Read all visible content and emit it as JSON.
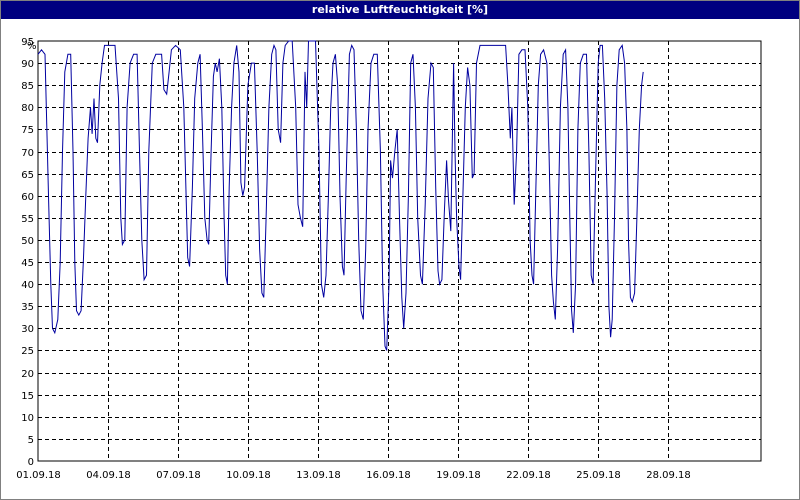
{
  "chart_data": {
    "type": "line",
    "title": "relative Luftfeuchtigkeit [%]",
    "ylabel": "%",
    "xlabel": "",
    "ylim": [
      0,
      95
    ],
    "yticks": [
      0,
      5,
      10,
      15,
      20,
      25,
      30,
      35,
      40,
      45,
      50,
      55,
      60,
      65,
      70,
      75,
      80,
      85,
      90,
      95
    ],
    "xlim": [
      0,
      31
    ],
    "xticks": [
      {
        "day": 0,
        "label": "01.09.18"
      },
      {
        "day": 3,
        "label": "04.09.18"
      },
      {
        "day": 6,
        "label": "07.09.18"
      },
      {
        "day": 9,
        "label": "10.09.18"
      },
      {
        "day": 12,
        "label": "13.09.18"
      },
      {
        "day": 15,
        "label": "16.09.18"
      },
      {
        "day": 18,
        "label": "19.09.18"
      },
      {
        "day": 21,
        "label": "22.09.18"
      },
      {
        "day": 24,
        "label": "25.09.18"
      },
      {
        "day": 27,
        "label": "28.09.18"
      }
    ],
    "grid": true,
    "line_color": "#0000a0",
    "series": [
      {
        "name": "",
        "points": [
          [
            0.0,
            92
          ],
          [
            0.15,
            93
          ],
          [
            0.3,
            92
          ],
          [
            0.45,
            60
          ],
          [
            0.55,
            40
          ],
          [
            0.62,
            30
          ],
          [
            0.72,
            29
          ],
          [
            0.85,
            32
          ],
          [
            0.95,
            45
          ],
          [
            1.05,
            70
          ],
          [
            1.15,
            88
          ],
          [
            1.28,
            92
          ],
          [
            1.4,
            92
          ],
          [
            1.5,
            70
          ],
          [
            1.58,
            45
          ],
          [
            1.65,
            34
          ],
          [
            1.75,
            33
          ],
          [
            1.85,
            34
          ],
          [
            1.95,
            46
          ],
          [
            2.05,
            60
          ],
          [
            2.15,
            73
          ],
          [
            2.25,
            80
          ],
          [
            2.32,
            74
          ],
          [
            2.4,
            82
          ],
          [
            2.48,
            73
          ],
          [
            2.55,
            72
          ],
          [
            2.65,
            85
          ],
          [
            2.75,
            90
          ],
          [
            2.85,
            94
          ],
          [
            3.1,
            94
          ],
          [
            3.3,
            94
          ],
          [
            3.45,
            82
          ],
          [
            3.55,
            55
          ],
          [
            3.62,
            49
          ],
          [
            3.72,
            50
          ],
          [
            3.82,
            80
          ],
          [
            3.95,
            90
          ],
          [
            4.1,
            92
          ],
          [
            4.25,
            92
          ],
          [
            4.35,
            70
          ],
          [
            4.45,
            50
          ],
          [
            4.55,
            41
          ],
          [
            4.65,
            42
          ],
          [
            4.75,
            70
          ],
          [
            4.9,
            90
          ],
          [
            5.05,
            92
          ],
          [
            5.3,
            92
          ],
          [
            5.4,
            84
          ],
          [
            5.52,
            83
          ],
          [
            5.62,
            88
          ],
          [
            5.72,
            93
          ],
          [
            5.9,
            94
          ],
          [
            6.1,
            93
          ],
          [
            6.25,
            80
          ],
          [
            6.35,
            60
          ],
          [
            6.42,
            46
          ],
          [
            6.5,
            44
          ],
          [
            6.62,
            62
          ],
          [
            6.72,
            82
          ],
          [
            6.85,
            90
          ],
          [
            6.95,
            92
          ],
          [
            7.05,
            75
          ],
          [
            7.15,
            55
          ],
          [
            7.25,
            50
          ],
          [
            7.32,
            49
          ],
          [
            7.42,
            70
          ],
          [
            7.52,
            87
          ],
          [
            7.6,
            90
          ],
          [
            7.68,
            88
          ],
          [
            7.78,
            91
          ],
          [
            7.88,
            80
          ],
          [
            7.98,
            55
          ],
          [
            8.05,
            42
          ],
          [
            8.12,
            40
          ],
          [
            8.2,
            62
          ],
          [
            8.3,
            80
          ],
          [
            8.4,
            90
          ],
          [
            8.52,
            94
          ],
          [
            8.62,
            88
          ],
          [
            8.7,
            63
          ],
          [
            8.78,
            60
          ],
          [
            8.86,
            62
          ],
          [
            9.0,
            85
          ],
          [
            9.15,
            90
          ],
          [
            9.28,
            90
          ],
          [
            9.4,
            70
          ],
          [
            9.5,
            48
          ],
          [
            9.6,
            38
          ],
          [
            9.68,
            37
          ],
          [
            9.78,
            55
          ],
          [
            9.9,
            80
          ],
          [
            10.02,
            92
          ],
          [
            10.12,
            94
          ],
          [
            10.2,
            93
          ],
          [
            10.3,
            75
          ],
          [
            10.4,
            72
          ],
          [
            10.5,
            90
          ],
          [
            10.6,
            94
          ],
          [
            10.75,
            95
          ],
          [
            10.9,
            95
          ],
          [
            11.05,
            80
          ],
          [
            11.15,
            58
          ],
          [
            11.25,
            55
          ],
          [
            11.35,
            53
          ],
          [
            11.45,
            88
          ],
          [
            11.52,
            80
          ],
          [
            11.6,
            95
          ],
          [
            11.75,
            95
          ],
          [
            11.9,
            95
          ],
          [
            12.05,
            70
          ],
          [
            12.15,
            40
          ],
          [
            12.25,
            37
          ],
          [
            12.35,
            42
          ],
          [
            12.45,
            60
          ],
          [
            12.55,
            80
          ],
          [
            12.65,
            90
          ],
          [
            12.75,
            92
          ],
          [
            12.85,
            85
          ],
          [
            12.95,
            60
          ],
          [
            13.05,
            44
          ],
          [
            13.12,
            42
          ],
          [
            13.22,
            65
          ],
          [
            13.35,
            92
          ],
          [
            13.45,
            94
          ],
          [
            13.55,
            93
          ],
          [
            13.65,
            75
          ],
          [
            13.75,
            50
          ],
          [
            13.85,
            34
          ],
          [
            13.95,
            32
          ],
          [
            14.05,
            48
          ],
          [
            14.15,
            75
          ],
          [
            14.28,
            90
          ],
          [
            14.4,
            92
          ],
          [
            14.55,
            92
          ],
          [
            14.68,
            70
          ],
          [
            14.78,
            40
          ],
          [
            14.88,
            26
          ],
          [
            14.95,
            25
          ],
          [
            15.05,
            40
          ],
          [
            15.12,
            68
          ],
          [
            15.2,
            64
          ],
          [
            15.3,
            70
          ],
          [
            15.4,
            75
          ],
          [
            15.5,
            55
          ],
          [
            15.6,
            37
          ],
          [
            15.68,
            30
          ],
          [
            15.78,
            38
          ],
          [
            15.88,
            60
          ],
          [
            15.98,
            90
          ],
          [
            16.08,
            92
          ],
          [
            16.18,
            80
          ],
          [
            16.28,
            55
          ],
          [
            16.4,
            42
          ],
          [
            16.48,
            40
          ],
          [
            16.6,
            58
          ],
          [
            16.72,
            82
          ],
          [
            16.85,
            90
          ],
          [
            16.95,
            89
          ],
          [
            17.05,
            62
          ],
          [
            17.15,
            43
          ],
          [
            17.22,
            40
          ],
          [
            17.32,
            41
          ],
          [
            17.42,
            56
          ],
          [
            17.52,
            68
          ],
          [
            17.6,
            59
          ],
          [
            17.7,
            52
          ],
          [
            17.82,
            90
          ],
          [
            17.88,
            70
          ],
          [
            17.95,
            55
          ],
          [
            18.05,
            44
          ],
          [
            18.12,
            41
          ],
          [
            18.22,
            60
          ],
          [
            18.32,
            80
          ],
          [
            18.42,
            89
          ],
          [
            18.52,
            85
          ],
          [
            18.62,
            64
          ],
          [
            18.7,
            65
          ],
          [
            18.8,
            90
          ],
          [
            18.95,
            94
          ],
          [
            19.2,
            94
          ],
          [
            19.5,
            94
          ],
          [
            19.8,
            94
          ],
          [
            20.05,
            94
          ],
          [
            20.15,
            85
          ],
          [
            20.25,
            73
          ],
          [
            20.32,
            80
          ],
          [
            20.42,
            58
          ],
          [
            20.52,
            70
          ],
          [
            20.62,
            92
          ],
          [
            20.75,
            93
          ],
          [
            20.88,
            93
          ],
          [
            21.0,
            80
          ],
          [
            21.1,
            50
          ],
          [
            21.18,
            42
          ],
          [
            21.25,
            40
          ],
          [
            21.35,
            62
          ],
          [
            21.45,
            85
          ],
          [
            21.55,
            92
          ],
          [
            21.68,
            93
          ],
          [
            21.82,
            90
          ],
          [
            21.92,
            68
          ],
          [
            22.02,
            42
          ],
          [
            22.1,
            36
          ],
          [
            22.18,
            32
          ],
          [
            22.28,
            48
          ],
          [
            22.4,
            80
          ],
          [
            22.52,
            92
          ],
          [
            22.62,
            93
          ],
          [
            22.72,
            80
          ],
          [
            22.8,
            55
          ],
          [
            22.88,
            34
          ],
          [
            22.95,
            29
          ],
          [
            23.05,
            40
          ],
          [
            23.15,
            75
          ],
          [
            23.25,
            90
          ],
          [
            23.38,
            92
          ],
          [
            23.52,
            92
          ],
          [
            23.62,
            70
          ],
          [
            23.72,
            42
          ],
          [
            23.8,
            40
          ],
          [
            23.9,
            63
          ],
          [
            24.02,
            90
          ],
          [
            24.1,
            94
          ],
          [
            24.2,
            94
          ],
          [
            24.3,
            82
          ],
          [
            24.4,
            60
          ],
          [
            24.48,
            35
          ],
          [
            24.55,
            28
          ],
          [
            24.62,
            32
          ],
          [
            24.72,
            55
          ],
          [
            24.82,
            85
          ],
          [
            24.92,
            93
          ],
          [
            25.05,
            94
          ],
          [
            25.15,
            90
          ],
          [
            25.25,
            75
          ],
          [
            25.32,
            50
          ],
          [
            25.4,
            37
          ],
          [
            25.48,
            36
          ],
          [
            25.58,
            38
          ],
          [
            25.68,
            55
          ],
          [
            25.78,
            75
          ],
          [
            25.88,
            85
          ],
          [
            25.95,
            88
          ]
        ]
      }
    ]
  }
}
